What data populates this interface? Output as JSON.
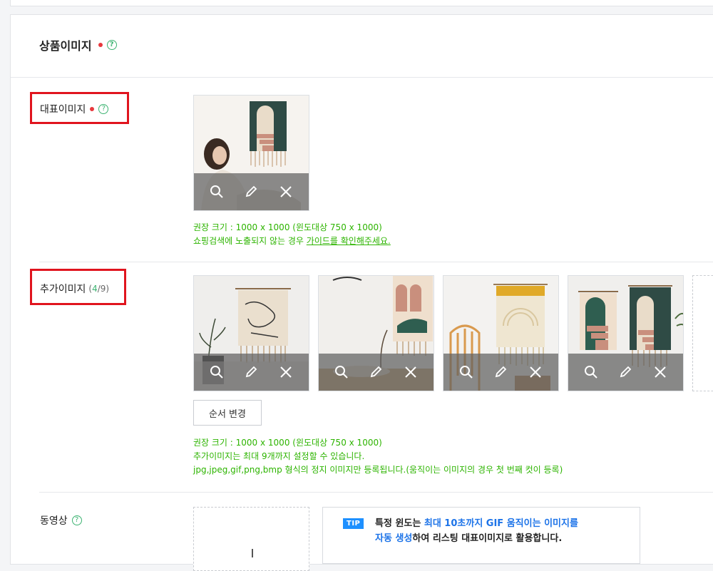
{
  "section": {
    "title": "상품이미지",
    "help": "?"
  },
  "main_image": {
    "label": "대표이미지",
    "help": "?",
    "hint_line1": "권장 크기 : 1000 x 1000 (윈도대상 750 x 1000)",
    "hint_line2_prefix": "쇼핑검색에 노출되지 않는 경우 ",
    "hint_line2_link": "가이드를 확인해주세요."
  },
  "additional_images": {
    "label": "추가이미지",
    "count_open": "(",
    "count_current": "4",
    "count_close": "/9)",
    "order_button": "순서 변경",
    "hint_line1": "권장 크기 : 1000 x 1000 (윈도대상 750 x 1000)",
    "hint_line2": "추가이미지는 최대 9개까지 설정할 수 있습니다.",
    "hint_line3": "jpg,jpeg,gif,png,bmp 형식의 정지 이미지만 등록됩니다.(움직이는 이미지의 경우 첫 번째 컷이 등록)"
  },
  "video": {
    "label": "동영상",
    "help": "?",
    "tip_badge": "TIP",
    "tip_part1": "특정 윈도는 ",
    "tip_highlight1": "최대 10초까지 GIF 움직이는 이미지를",
    "tip_highlight2": "자동 생성",
    "tip_part2": "하여 리스팅 대표이미지로 활용합니다."
  },
  "colors": {
    "accent_green": "#2db400",
    "required_red": "#e8383d",
    "highlight_box": "#e0141e",
    "tip_blue": "#1c73e8"
  }
}
